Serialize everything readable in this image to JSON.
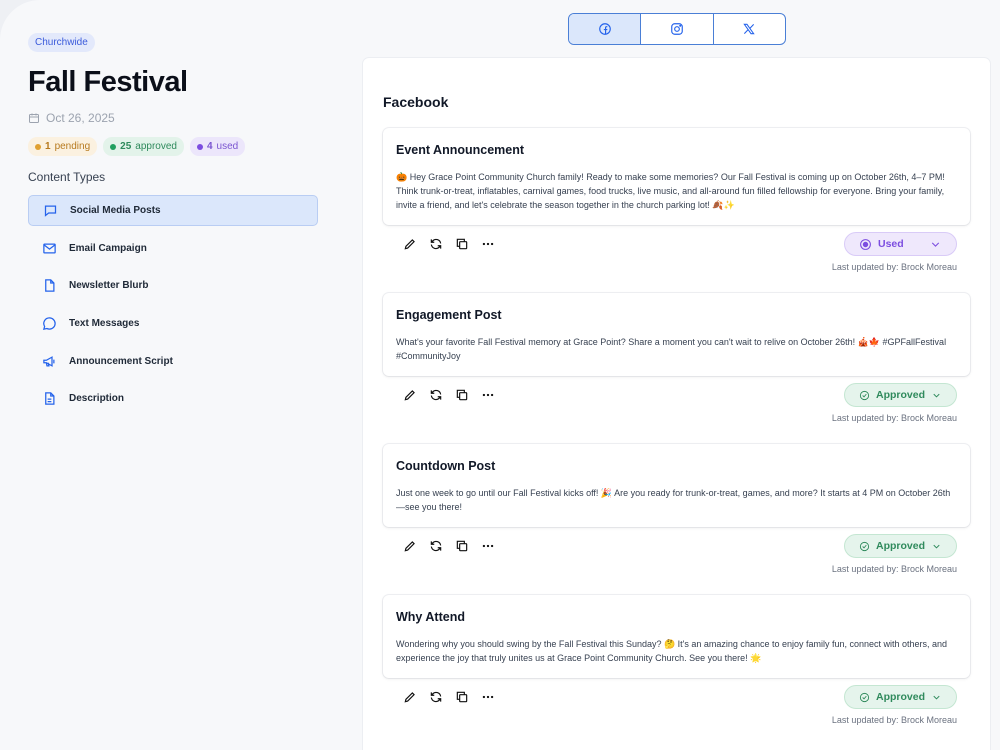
{
  "event": {
    "tag": "Churchwide",
    "title": "Fall Festival",
    "date": "Oct 26, 2025",
    "badges": {
      "pending_count": "1",
      "pending_label": "pending",
      "approved_count": "25",
      "approved_label": "approved",
      "used_count": "4",
      "used_label": "used"
    }
  },
  "sidebar": {
    "section_label": "Content Types",
    "items": [
      {
        "label": "Social Media Posts",
        "icon": "chat-bubble-icon"
      },
      {
        "label": "Email Campaign",
        "icon": "mail-icon"
      },
      {
        "label": "Newsletter Blurb",
        "icon": "document-icon"
      },
      {
        "label": "Text Messages",
        "icon": "message-circle-icon"
      },
      {
        "label": "Announcement Script",
        "icon": "megaphone-icon"
      },
      {
        "label": "Description",
        "icon": "file-text-icon"
      }
    ]
  },
  "platforms": [
    "facebook-icon",
    "instagram-icon",
    "x-icon"
  ],
  "panel": {
    "title": "Facebook",
    "posts": [
      {
        "title": "Event Announcement",
        "body": "🎃 Hey Grace Point Community Church family! Ready to make some memories? Our Fall Festival is coming up on October 26th, 4–7 PM! Think trunk-or-treat, inflatables, carnival games, food trucks, live music, and all-around fun filled fellowship for everyone. Bring your family, invite a friend, and let's celebrate the season together in the church parking lot! 🍂✨",
        "status": "Used",
        "updated": "Last updated by: Brock Moreau"
      },
      {
        "title": "Engagement Post",
        "body": "What's your favorite Fall Festival memory at Grace Point? Share a moment you can't wait to relive on October 26th! 🎪🍁 #GPFallFestival #CommunityJoy",
        "status": "Approved",
        "updated": "Last updated by: Brock Moreau"
      },
      {
        "title": "Countdown Post",
        "body": "Just one week to go until our Fall Festival kicks off! 🎉 Are you ready for trunk-or-treat, games, and more? It starts at 4 PM on October 26th—see you there!",
        "status": "Approved",
        "updated": "Last updated by: Brock Moreau"
      },
      {
        "title": "Why Attend",
        "body": "Wondering why you should swing by the Fall Festival this Sunday? 🤔 It's an amazing chance to enjoy family fun, connect with others, and experience the joy that truly unites us at Grace Point Community Church. See you there! 🌟",
        "status": "Approved",
        "updated": "Last updated by: Brock Moreau"
      }
    ]
  },
  "colors": {
    "accent": "#4a7fd6",
    "approved": "#2f8a5c",
    "used": "#7c4de0",
    "pending": "#e0a030"
  }
}
